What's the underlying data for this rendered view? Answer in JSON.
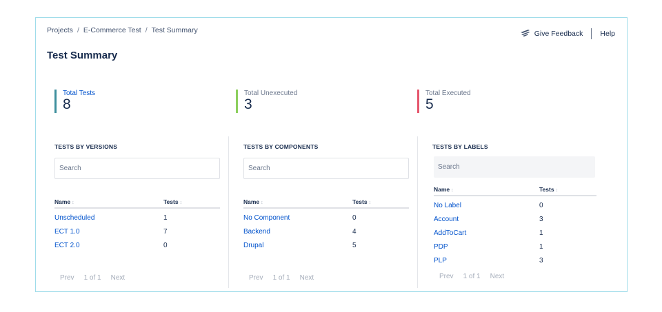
{
  "breadcrumb": [
    "Projects",
    "E-Commerce Test",
    "Test Summary"
  ],
  "breadcrumb_separator": "/",
  "actions": {
    "feedback": "Give Feedback",
    "help": "Help"
  },
  "page_title": "Test Summary",
  "stats": [
    {
      "label": "Total Tests",
      "value": "8",
      "color": "#3d8f9d"
    },
    {
      "label": "Total Unexecuted",
      "value": "3",
      "color": "#8ccf5d"
    },
    {
      "label": "Total Executed",
      "value": "5",
      "color": "#e5566d"
    }
  ],
  "columns": [
    {
      "title": "TESTS BY VERSIONS",
      "search_placeholder": "Search",
      "header_name": "Name",
      "header_tests": "Tests",
      "rows": [
        {
          "name": "Unscheduled",
          "tests": "1"
        },
        {
          "name": "ECT 1.0",
          "tests": "7"
        },
        {
          "name": "ECT 2.0",
          "tests": "0"
        }
      ],
      "pager": {
        "prev": "Prev",
        "page": "1 of 1",
        "next": "Next"
      }
    },
    {
      "title": "TESTS BY COMPONENTS",
      "search_placeholder": "Search",
      "header_name": "Name",
      "header_tests": "Tests",
      "rows": [
        {
          "name": "No Component",
          "tests": "0"
        },
        {
          "name": "Backend",
          "tests": "4"
        },
        {
          "name": "Drupal",
          "tests": "5"
        }
      ],
      "pager": {
        "prev": "Prev",
        "page": "1 of 1",
        "next": "Next"
      }
    },
    {
      "title": "TESTS BY LABELS",
      "search_placeholder": "Search",
      "header_name": "Name",
      "header_tests": "Tests",
      "rows": [
        {
          "name": "No Label",
          "tests": "0"
        },
        {
          "name": "Account",
          "tests": "3"
        },
        {
          "name": "AddToCart",
          "tests": "1"
        },
        {
          "name": "PDP",
          "tests": "1"
        },
        {
          "name": "PLP",
          "tests": "3"
        }
      ],
      "pager": {
        "prev": "Prev",
        "page": "1 of 1",
        "next": "Next"
      }
    }
  ]
}
